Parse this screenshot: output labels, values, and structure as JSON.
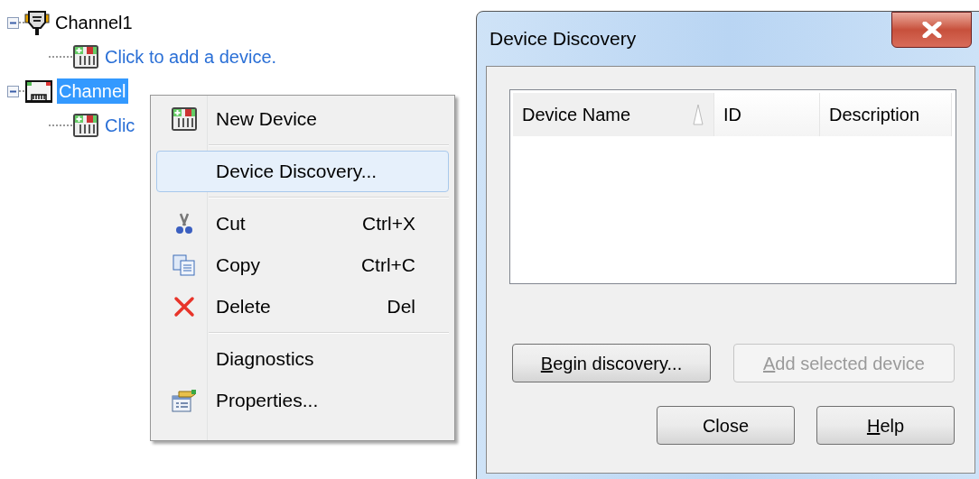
{
  "tree": [
    {
      "label": "Channel1",
      "expanded": true,
      "selected": false,
      "children": [
        {
          "label": "Click to add a device."
        }
      ]
    },
    {
      "label": "Channel",
      "expanded": true,
      "selected": true,
      "children": [
        {
          "label": "Clic"
        }
      ]
    }
  ],
  "context_menu": {
    "groups": [
      [
        {
          "label": "New Device",
          "selected": false
        }
      ],
      [
        {
          "label": "Device Discovery...",
          "selected": true
        }
      ],
      [
        {
          "label": "Cut",
          "shortcut": "Ctrl+X",
          "selected": false
        },
        {
          "label": "Copy",
          "shortcut": "Ctrl+C",
          "selected": false
        },
        {
          "label": "Delete",
          "shortcut": "Del",
          "selected": false
        }
      ],
      [
        {
          "label": "Diagnostics",
          "selected": false
        },
        {
          "label": "Properties...",
          "selected": false
        }
      ]
    ]
  },
  "dialog": {
    "title": "Device Discovery",
    "table": {
      "columns": [
        {
          "label": "Device Name",
          "sorted": true
        },
        {
          "label": "ID",
          "sorted": false
        },
        {
          "label": "Description",
          "sorted": false
        }
      ]
    },
    "buttons": [
      {
        "label": "Begin discovery...",
        "disabled": false,
        "underline_first": true
      },
      {
        "label": "Add selected device",
        "disabled": true,
        "underline_first": true
      },
      {
        "label": "Close",
        "disabled": false,
        "underline_first": false
      },
      {
        "label": "Help",
        "disabled": false,
        "underline_first": true
      }
    ]
  }
}
